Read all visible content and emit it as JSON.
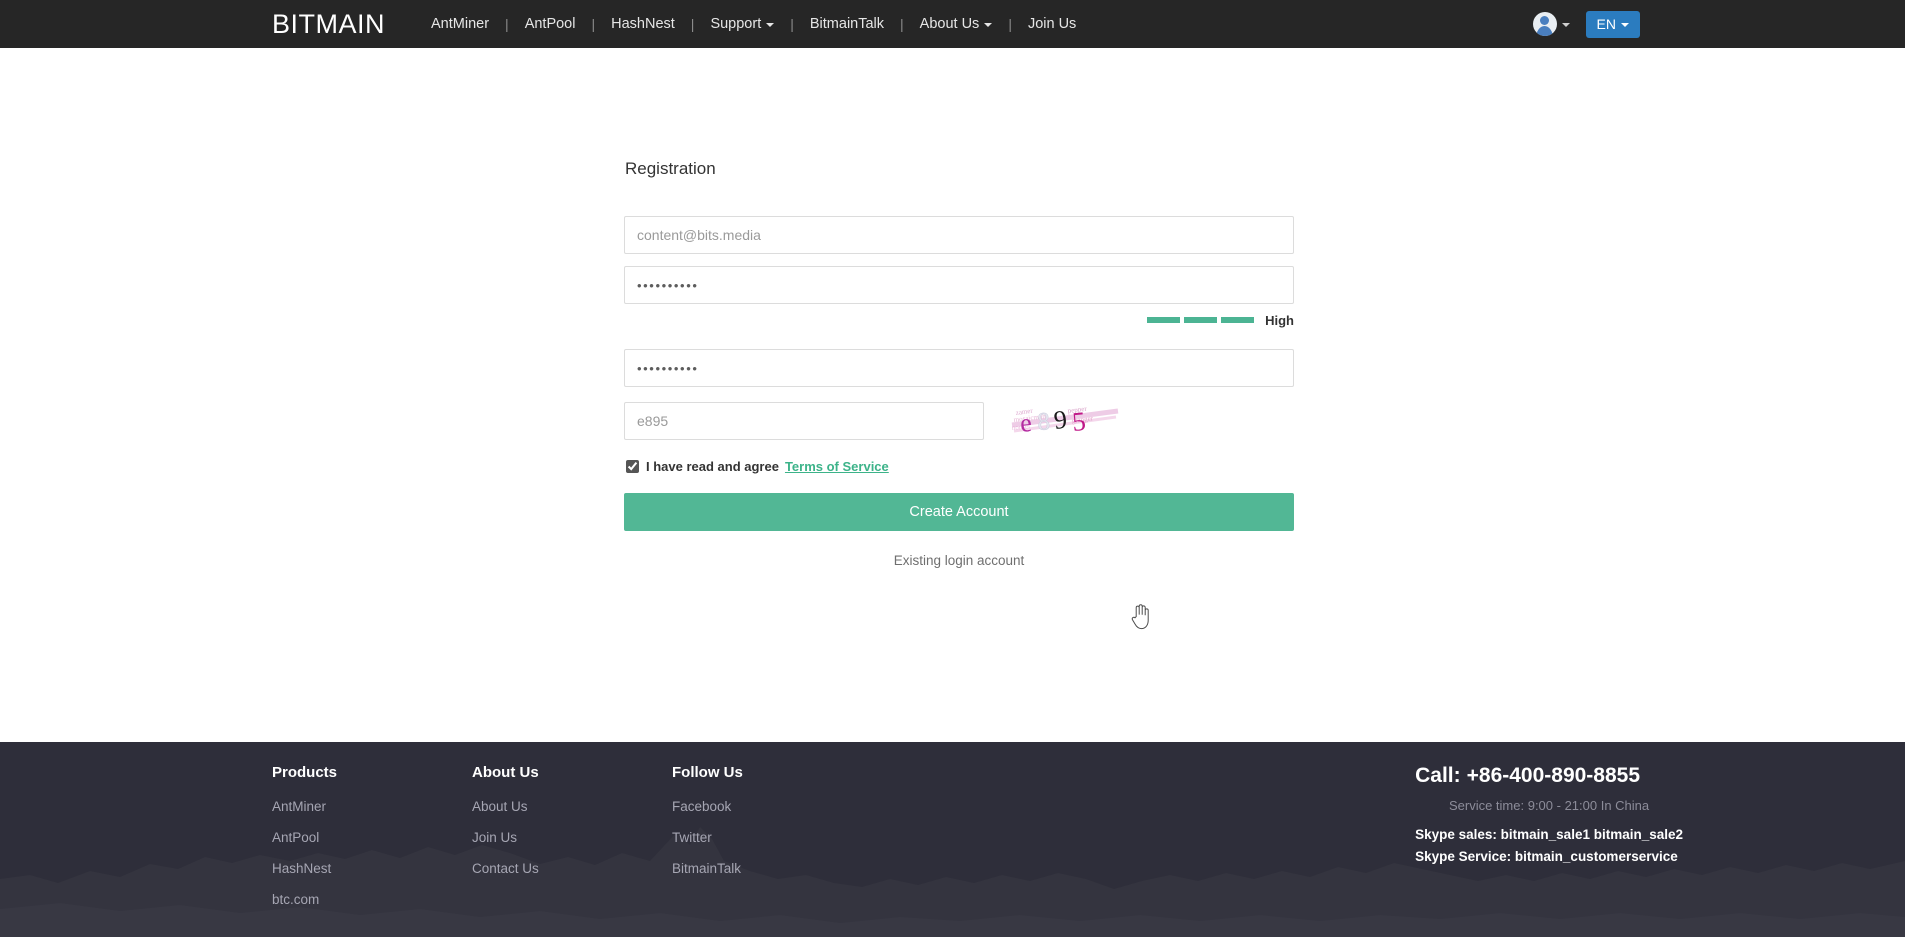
{
  "header": {
    "brand": "BITMAIN",
    "nav": [
      {
        "label": "AntMiner",
        "caret": false
      },
      {
        "label": "AntPool",
        "caret": false
      },
      {
        "label": "HashNest",
        "caret": false
      },
      {
        "label": "Support",
        "caret": true
      },
      {
        "label": "BitmainTalk",
        "caret": false
      },
      {
        "label": "About Us",
        "caret": true
      },
      {
        "label": "Join Us",
        "caret": false
      }
    ],
    "separator": "|",
    "account_icon": "user-avatar-icon",
    "language": "EN",
    "language_accent": "#2b7cbf"
  },
  "main": {
    "title": "Registration",
    "email": {
      "value": "content@bits.media",
      "placeholder": "Email"
    },
    "password": {
      "value": "••••••••••",
      "placeholder": "Password"
    },
    "password_strength": {
      "label": "High",
      "filled_segments": 3,
      "total_segments": 3,
      "color": "#4cb493"
    },
    "confirm_password": {
      "value": "••••••••••",
      "placeholder": "Confirm password"
    },
    "captcha": {
      "value": "e895",
      "placeholder": "Captcha",
      "image_text": "e895",
      "image_name": "captcha-image"
    },
    "terms": {
      "checked": true,
      "text": "I have read and agree",
      "link_label": "Terms of Service",
      "link_color": "#3cb389"
    },
    "submit_label": "Create Account",
    "submit_color": "#52b795",
    "existing_account_label": "Existing login account"
  },
  "footer": {
    "background": "#2e2e3a",
    "columns": [
      {
        "heading": "Products",
        "links": [
          "AntMiner",
          "AntPool",
          "HashNest",
          "btc.com"
        ]
      },
      {
        "heading": "About Us",
        "links": [
          "About Us",
          "Join Us",
          "Contact Us"
        ]
      },
      {
        "heading": "Follow Us",
        "links": [
          "Facebook",
          "Twitter",
          "BitmainTalk"
        ]
      }
    ],
    "contact": {
      "call_label": "Call:",
      "phone": "+86-400-890-8855",
      "service_time": "Service time: 9:00 - 21:00 In China",
      "skype_sales": "Skype sales: bitmain_sale1 bitmain_sale2",
      "skype_service": "Skype Service: bitmain_customerservice"
    }
  }
}
